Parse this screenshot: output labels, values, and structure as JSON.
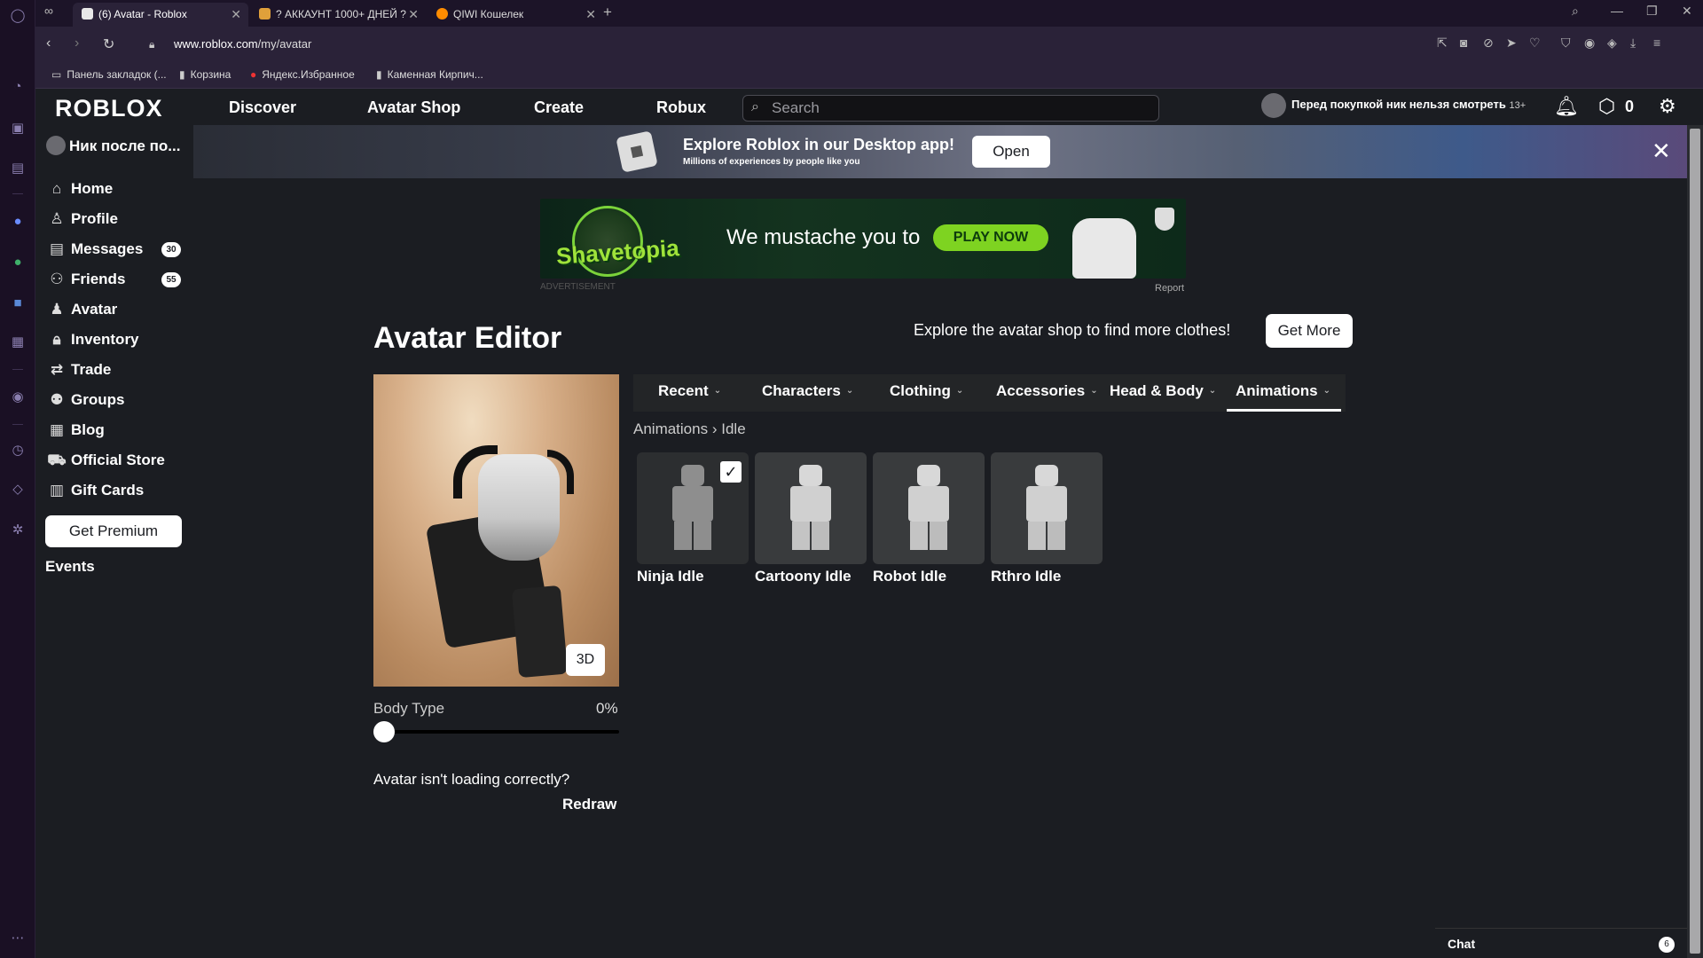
{
  "browser": {
    "tabs": [
      {
        "title": "(6) Avatar - Roblox",
        "color": "#e8e8e8"
      },
      {
        "title": "? АККАУНТ 1000+ ДНЕЙ ?",
        "color": "#e0a03a"
      },
      {
        "title": "QIWI Кошелек",
        "color": "#ff8c00"
      }
    ],
    "url_host": "www.roblox.com",
    "url_path": "/my/avatar",
    "bookmarks": [
      "Панель закладок (...",
      "Корзина",
      "Яндекс.Избранное",
      "Каменная Кирпич..."
    ]
  },
  "header": {
    "logo": "ROBLOX",
    "nav": [
      "Discover",
      "Avatar Shop",
      "Create",
      "Robux"
    ],
    "search_placeholder": "Search",
    "username": "Перед покупкой ник нельзя смотреть",
    "age_badge": "13+",
    "robux": "0"
  },
  "sidebar": {
    "username": "Ник после по...",
    "items": [
      {
        "label": "Home",
        "icon": "home-icon"
      },
      {
        "label": "Profile",
        "icon": "profile-icon"
      },
      {
        "label": "Messages",
        "icon": "messages-icon",
        "badge": "30"
      },
      {
        "label": "Friends",
        "icon": "friends-icon",
        "badge": "55"
      },
      {
        "label": "Avatar",
        "icon": "avatar-icon"
      },
      {
        "label": "Inventory",
        "icon": "inventory-icon"
      },
      {
        "label": "Trade",
        "icon": "trade-icon"
      },
      {
        "label": "Groups",
        "icon": "groups-icon"
      },
      {
        "label": "Blog",
        "icon": "blog-icon"
      },
      {
        "label": "Official Store",
        "icon": "store-icon"
      },
      {
        "label": "Gift Cards",
        "icon": "gift-card-icon"
      }
    ],
    "premium_label": "Get Premium",
    "events_label": "Events"
  },
  "desktop_banner": {
    "title": "Explore Roblox in our Desktop app!",
    "subtitle": "Millions of experiences by people like you",
    "open_label": "Open"
  },
  "ad": {
    "brand": "Shavetopia",
    "message": "We mustache you to",
    "cta": "PLAY NOW",
    "label": "ADVERTISEMENT",
    "report": "Report"
  },
  "editor": {
    "title": "Avatar Editor",
    "explore_text": "Explore the avatar shop to find more clothes!",
    "get_more_label": "Get More",
    "view_3d_label": "3D",
    "body_type_label": "Body Type",
    "body_type_value": "0%",
    "body_type_fraction": 0,
    "broken_question": "Avatar isn't loading correctly?",
    "redraw_label": "Redraw",
    "categories": [
      "Recent",
      "Characters",
      "Clothing",
      "Accessories",
      "Head & Body",
      "Animations"
    ],
    "active_category": "Animations",
    "breadcrumb_parent": "Animations",
    "breadcrumb_child": "Idle",
    "items": [
      {
        "name": "Ninja Idle",
        "selected": true
      },
      {
        "name": "Cartoony Idle",
        "selected": false
      },
      {
        "name": "Robot Idle",
        "selected": false
      },
      {
        "name": "Rthro Idle",
        "selected": false
      }
    ]
  },
  "chat": {
    "label": "Chat",
    "count": "6"
  }
}
